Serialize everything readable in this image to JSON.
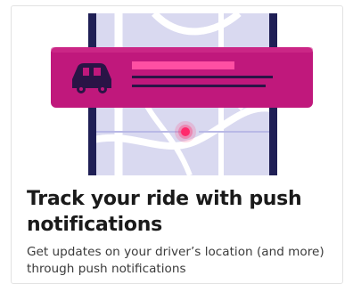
{
  "card": {
    "title": "Track your ride with push notifications",
    "subtitle": "Get updates on your driver’s location (and more) through push notifications"
  },
  "illustration": {
    "icon": "car-icon",
    "colors": {
      "banner": "#c0187c",
      "banner_highlight": "#ff4fa3",
      "map_background": "#d9d9f0",
      "map_roads": "#ffffff",
      "phone_frame": "#1f1f55",
      "location_pin": "#ff2a6d"
    }
  }
}
